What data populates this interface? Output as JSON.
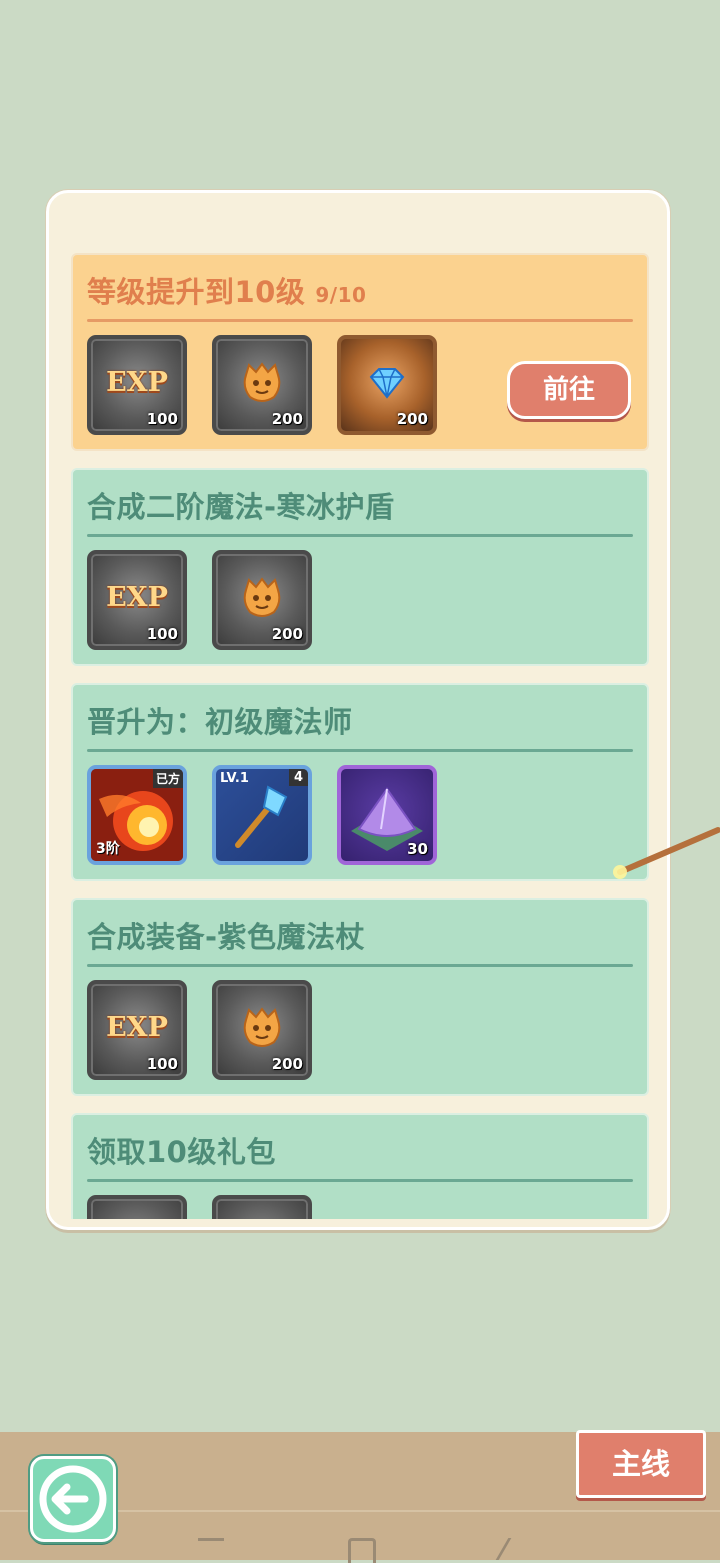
{
  "quests": [
    {
      "title": "等级提升到10级",
      "progress": "9/10",
      "state": "active",
      "button": "前往",
      "rewards": [
        {
          "icon": "exp-icon",
          "label": "EXP",
          "qty": "100"
        },
        {
          "icon": "gold-coin-icon",
          "qty": "200"
        },
        {
          "icon": "diamond-icon",
          "qty": "200"
        }
      ]
    },
    {
      "title": "合成二阶魔法-寒冰护盾",
      "rewards": [
        {
          "icon": "exp-icon",
          "label": "EXP",
          "qty": "100"
        },
        {
          "icon": "gold-coin-icon",
          "qty": "200"
        }
      ]
    },
    {
      "title": "晋升为：初级魔法师",
      "rewards": [
        {
          "icon": "fire-spell-icon",
          "badge": "3阶",
          "tag": "已方"
        },
        {
          "icon": "magic-staff-icon",
          "level": "LV.1",
          "count": "4"
        },
        {
          "icon": "purple-crystal-pile-icon",
          "qty": "30"
        }
      ]
    },
    {
      "title": "合成装备-紫色魔法杖",
      "rewards": [
        {
          "icon": "exp-icon",
          "label": "EXP",
          "qty": "100"
        },
        {
          "icon": "gold-coin-icon",
          "qty": "200"
        }
      ]
    },
    {
      "title": "领取10级礼包"
    }
  ],
  "bottom": {
    "main_button": "主线",
    "back_icon": "back-arrow-icon"
  }
}
